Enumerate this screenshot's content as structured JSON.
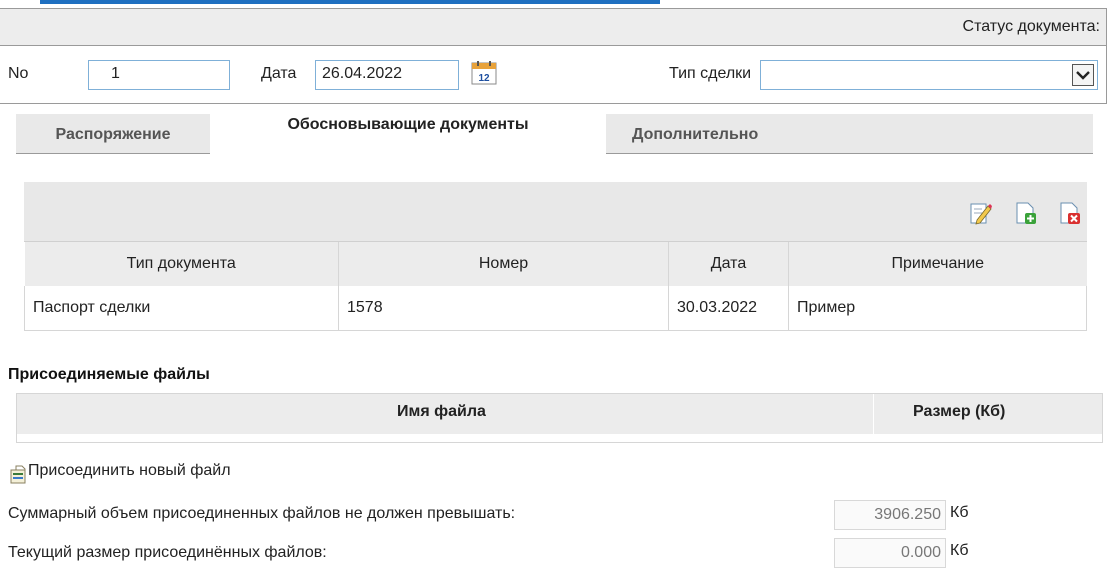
{
  "status": {
    "label": "Статус документа:"
  },
  "doc": {
    "number_label": "No",
    "number_value": "1",
    "date_label": "Дата",
    "date_value": "26.04.2022",
    "calendar_day": "12",
    "deal_type_label": "Тип сделки",
    "deal_type_value": ""
  },
  "tabs": [
    {
      "label": "Распоряжение"
    },
    {
      "label": "Обосновывающие документы"
    },
    {
      "label": "Дополнительно"
    }
  ],
  "docs_table": {
    "columns": [
      "Тип документа",
      "Номер",
      "Дата",
      "Примечание"
    ],
    "rows": [
      [
        "Паспорт сделки",
        "1578",
        "30.03.2022",
        "Пример"
      ]
    ]
  },
  "files": {
    "title": "Присоединяемые файлы",
    "columns": [
      "Имя файла",
      "Размер (Кб)"
    ],
    "attach_label": "Присоединить новый файл",
    "max_label": "Суммарный объем присоединенных файлов не должен превышать:",
    "max_value": "3906.250",
    "current_label": "Текущий размер присоединённых файлов:",
    "current_value": "0.000",
    "unit": "Кб"
  },
  "icons": {
    "calendar": "calendar-icon",
    "edit": "edit-document-icon",
    "add": "add-document-icon",
    "delete": "delete-document-icon",
    "attach": "attach-file-icon",
    "dropdown": "chevron-down-icon"
  },
  "colors": {
    "accent": "#1e6fc0",
    "field_border": "#7fb0d8",
    "header_bg": "#ececec"
  }
}
